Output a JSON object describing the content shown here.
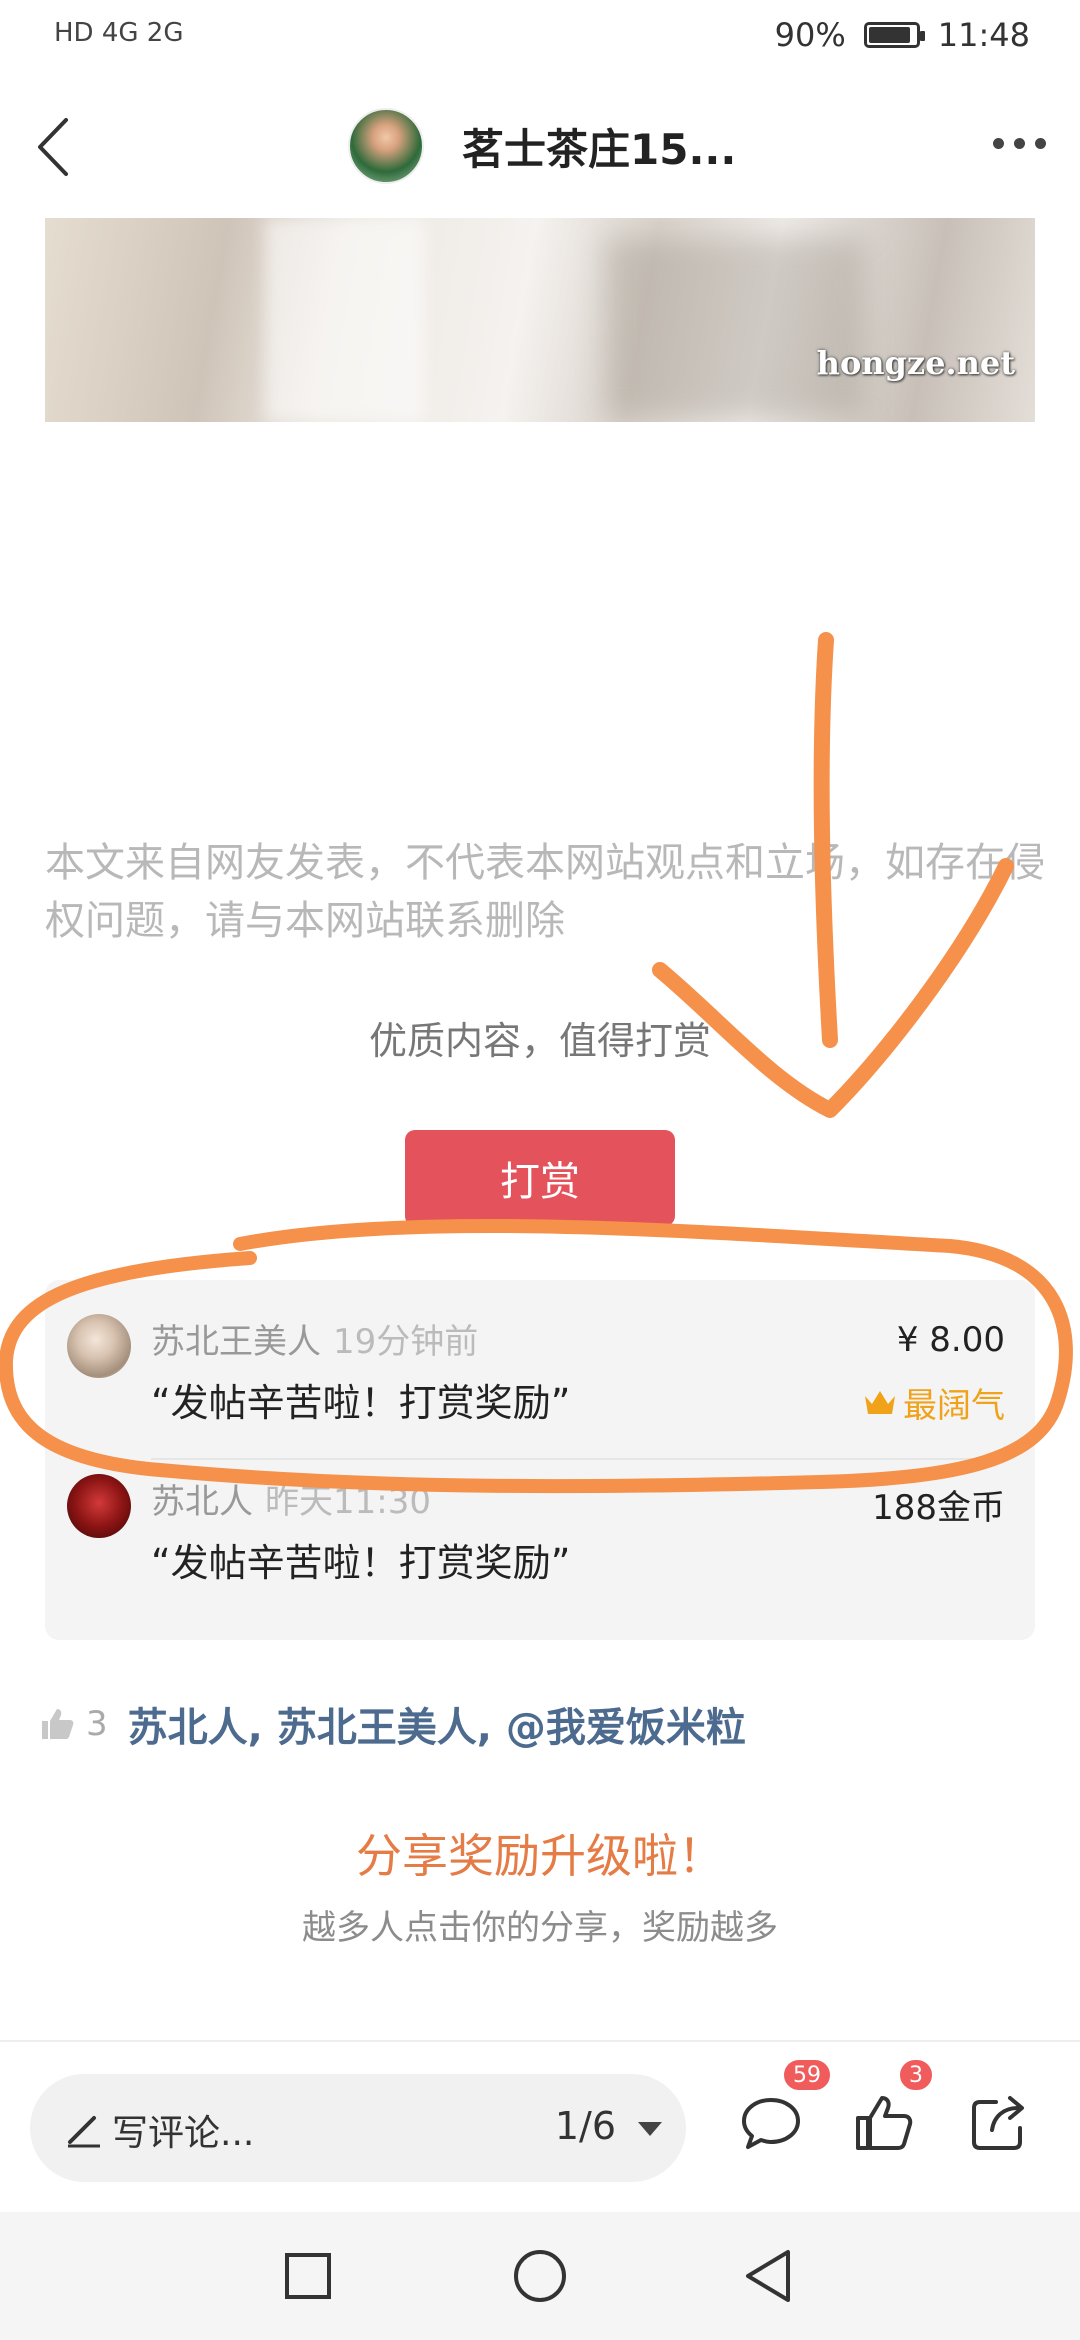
{
  "status_bar": {
    "left_icons": "HD 4G 2G",
    "battery": "90%",
    "battery_level": 0.9,
    "time": "11:48"
  },
  "header": {
    "title": "茗士茶庄15...",
    "back_icon": "chevron-left-icon",
    "more_icon": "more-dots-icon"
  },
  "image": {
    "watermark": "hongze.net"
  },
  "article": {
    "disclaimer": "本文来自网友发表，不代表本网站观点和立场，如存在侵权问题，请与本网站联系删除",
    "quality_text": "优质内容，值得打赏",
    "reward_button": "打赏"
  },
  "rewards": [
    {
      "name": "苏北王美人",
      "time": "19分钟前",
      "message": "“发帖辛苦啦！打赏奖励”",
      "amount": "¥ 8.00",
      "badge": "最阔气",
      "badge_icon": "crown-icon"
    },
    {
      "name": "苏北人",
      "time": "昨天11:30",
      "message": "“发帖辛苦啦！打赏奖励”",
      "amount": "188金币"
    }
  ],
  "likes": {
    "count": "3",
    "names": "苏北人, 苏北王美人, @我爱饭米粒"
  },
  "share": {
    "title": "分享奖励升级啦！",
    "subtitle": "越多人点击你的分享，奖励越多"
  },
  "bottom_bar": {
    "comment_placeholder": "写评论...",
    "page_indicator": "1/6",
    "comment_count": "59",
    "like_count": "3"
  },
  "colors": {
    "accent_red": "#e4525b",
    "annotation_orange": "#f5914a",
    "link_blue": "#4d6a8f",
    "gold": "#f0a21a"
  }
}
